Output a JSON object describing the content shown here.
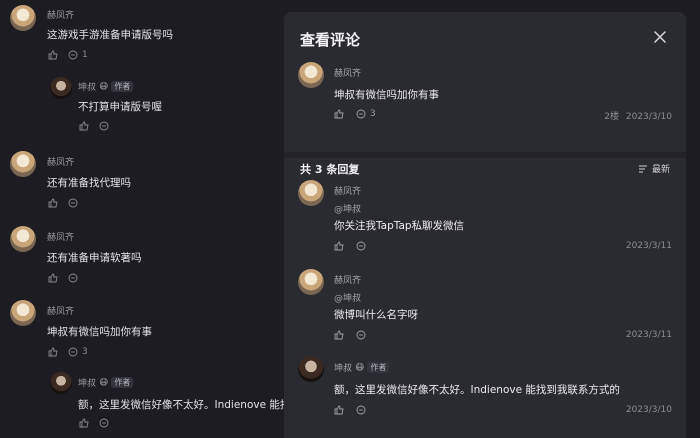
{
  "feed": {
    "c1": {
      "name": "赫凤齐",
      "text": "这游戏手游准备申请版号吗",
      "reply_count": "1"
    },
    "r1": {
      "name": "坤叔",
      "badge": "作者",
      "emoji": "😷",
      "text": "不打算申请版号喔"
    },
    "c2": {
      "name": "赫凤齐",
      "text": "还有准备找代理吗"
    },
    "c3": {
      "name": "赫凤齐",
      "text": "还有准备申请软著吗"
    },
    "c4": {
      "name": "赫凤齐",
      "text": "坤叔有微信吗加你有事",
      "reply_count": "3"
    },
    "r4": {
      "name": "坤叔",
      "badge": "作者",
      "emoji": "😷",
      "text": "额，这里发微信好像不太好。Indienove 能找"
    }
  },
  "modal": {
    "title": "查看评论",
    "main": {
      "name": "赫凤齐",
      "text": "坤叔有微信吗加你有事",
      "reply_count": "3",
      "floor": "2楼",
      "date": "2023/3/10"
    },
    "replies_header": "共 3 条回复",
    "sort_label": "最新",
    "replies": [
      {
        "name": "赫凤齐",
        "ref": "@坤叔",
        "text": "你关注我TapTap私聊发微信",
        "date": "2023/3/11"
      },
      {
        "name": "赫凤齐",
        "ref": "@坤叔",
        "text": "微博叫什么名字呀",
        "date": "2023/3/11"
      },
      {
        "name": "坤叔",
        "badge": "作者",
        "emoji": "😷",
        "text": "额，这里发微信好像不太好。Indienove 能找到我联系方式的",
        "date": "2023/3/10"
      }
    ]
  },
  "icons": [
    "thumbs-up-icon",
    "comment-icon",
    "close-icon",
    "sort-icon"
  ]
}
